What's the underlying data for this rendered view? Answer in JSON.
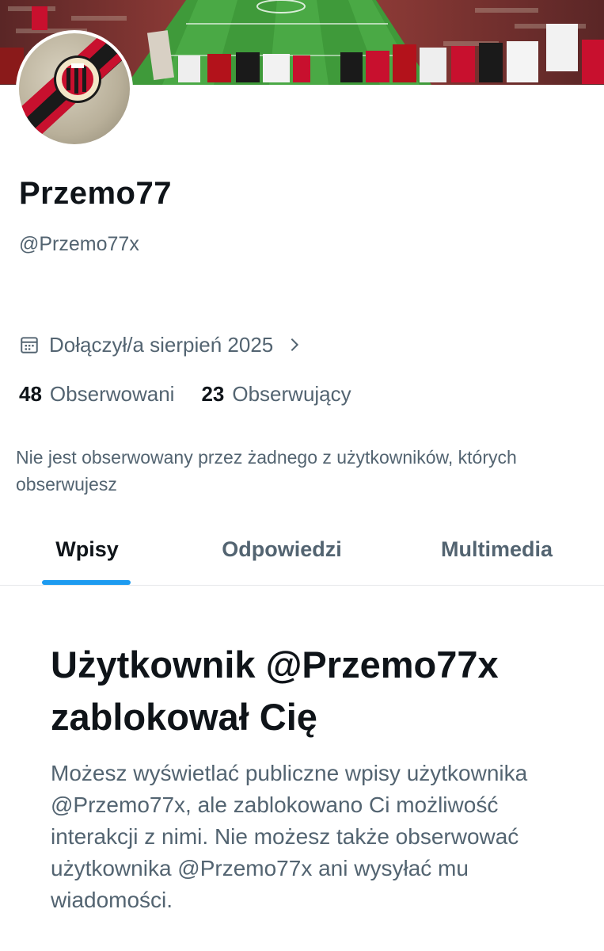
{
  "profile": {
    "display_name": "Przemo77",
    "handle": "@Przemo77x",
    "joined": "Dołączył/a sierpień 2025",
    "following_count": "48",
    "following_label": "Obserwowani",
    "followers_count": "23",
    "followers_label": "Obserwujący",
    "not_followed_note": "Nie jest obserwowany przez żadnego z użytkowników, których obserwujesz"
  },
  "tabs": [
    {
      "label": "Wpisy",
      "active": true
    },
    {
      "label": "Odpowiedzi",
      "active": false
    },
    {
      "label": "Multimedia",
      "active": false
    }
  ],
  "blocked": {
    "title": "Użytkownik @Przemo77x zablokował Cię",
    "description": "Możesz wyświetlać publiczne wpisy użytkownika @Przemo77x, ale zablokowano Ci możliwość interakcji z nimi. Nie możesz także obserwować użytkownika @Przemo77x ani wysyłać mu wiadomości."
  },
  "icons": {
    "calendar": "calendar-icon",
    "chevron": "chevron-right-icon"
  },
  "colors": {
    "accent": "#1d9bf0",
    "text_primary": "#0f1419",
    "text_secondary": "#536471",
    "club_red": "#c8102e"
  }
}
